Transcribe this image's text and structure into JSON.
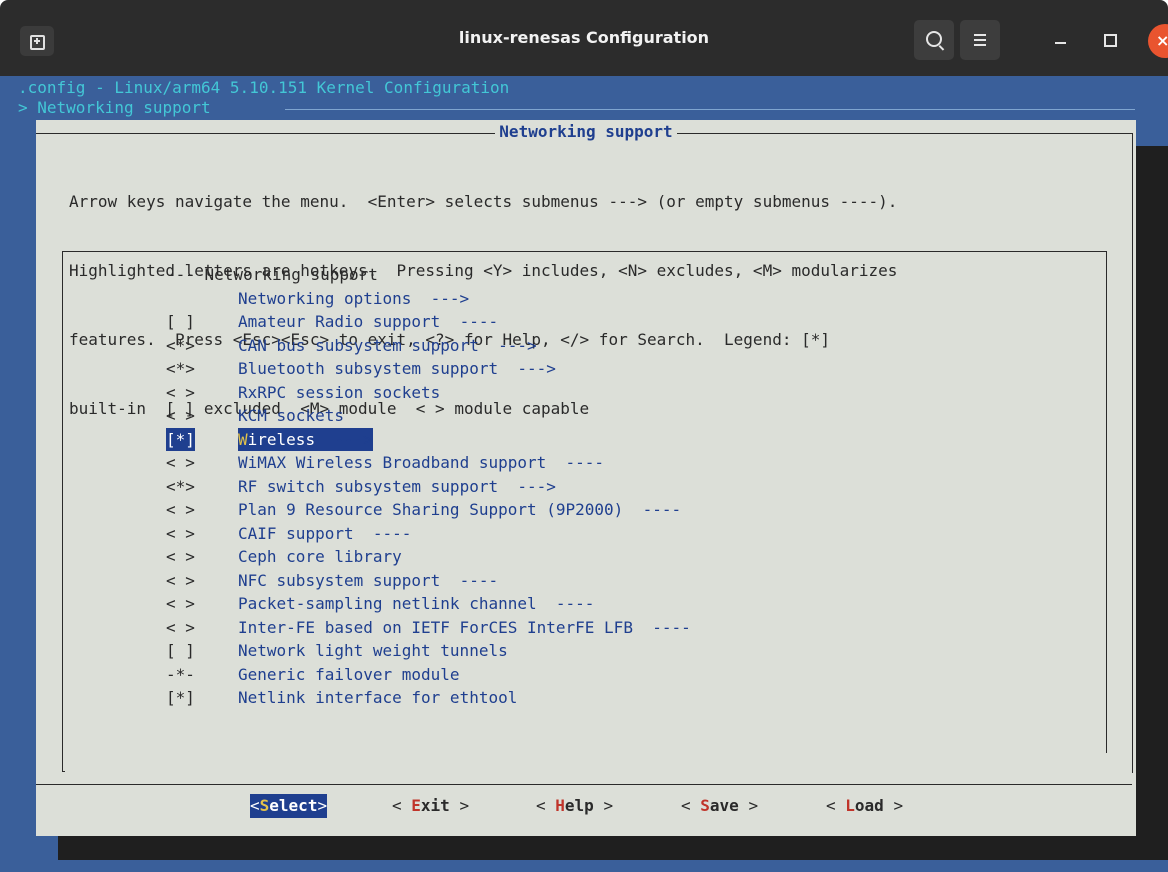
{
  "window": {
    "title": "linux-renesas Configuration",
    "close_glyph": "×",
    "icons": [
      "new-tab-icon",
      "search-icon",
      "hamburger-menu-icon",
      "minimize-icon",
      "maximize-icon",
      "close-icon"
    ]
  },
  "terminal": {
    "path_line": ".config - Linux/arm64 5.10.151 Kernel Configuration",
    "breadcrumb": "> Networking support"
  },
  "dialog": {
    "title": "Networking support",
    "help_lines": [
      "Arrow keys navigate the menu.  <Enter> selects submenus ---> (or empty submenus ----).",
      "Highlighted letters are hotkeys.  Pressing <Y> includes, <N> excludes, <M> modularizes",
      "features.  Press <Esc><Esc> to exit, <?> for Help, </> for Search.  Legend: [*]",
      "built-in  [ ] excluded  <M> module  < > module capable"
    ],
    "items": [
      {
        "mark": "---",
        "hot": "",
        "label": "Networking support",
        "tail": ""
      },
      {
        "mark": "",
        "hot": "Ne",
        "label": "tworking options",
        "tail": "  --->"
      },
      {
        "mark": "[ ]",
        "hot": "A",
        "label": "mateur Radio support",
        "tail": "  ----"
      },
      {
        "mark": "<*>",
        "hot": "",
        "label": "CAN bus subsystem support",
        "tail": "  --->"
      },
      {
        "mark": "<*>",
        "hot": "",
        "label": "Bluetooth subsystem support",
        "tail": "  --->"
      },
      {
        "mark": "< >",
        "hot": "R",
        "label": "xRPC session sockets",
        "tail": ""
      },
      {
        "mark": "< >",
        "hot": "K",
        "label": "CM sockets",
        "tail": ""
      },
      {
        "mark": "[*]",
        "hot": "W",
        "label": "ireless",
        "tail": "  --->"
      },
      {
        "mark": "< >",
        "hot": "W",
        "label": "iMAX Wireless Broadband support",
        "tail": "  ----"
      },
      {
        "mark": "<*>",
        "hot": "R",
        "label": "F switch subsystem support",
        "tail": "  --->"
      },
      {
        "mark": "< >",
        "hot": "",
        "label": "Plan 9 Resource Sharing Support (9P2000)",
        "tail": "  ----"
      },
      {
        "mark": "< >",
        "hot": "C",
        "label": "AIF support",
        "tail": "  ----"
      },
      {
        "mark": "< >",
        "hot": "",
        "label": "Ceph core library",
        "tail": ""
      },
      {
        "mark": "< >",
        "hot": "N",
        "label": "FC subsystem support",
        "tail": "  ----"
      },
      {
        "mark": "< >",
        "hot": "",
        "label": "Packet-sampling netlink channel",
        "tail": "  ----"
      },
      {
        "mark": "< >",
        "hot": "",
        "label": "Inter-FE based on IETF ForCES InterFE LFB",
        "tail": "  ----"
      },
      {
        "mark": "[ ]",
        "hot": "Ne",
        "label": "twork light weight tunnels",
        "tail": ""
      },
      {
        "mark": "-*-",
        "hot": "",
        "label": "Generic failover module",
        "tail": ""
      },
      {
        "mark": "[*]",
        "hot": "Net",
        "label": "link interface for ethtool",
        "tail": ""
      }
    ],
    "selected_index": 7,
    "buttons": [
      {
        "pre": "<",
        "hot": "S",
        "rest": "elect",
        "post": ">"
      },
      {
        "pre": "< ",
        "hot": "E",
        "rest": "xit",
        "post": " >"
      },
      {
        "pre": "< ",
        "hot": "H",
        "rest": "elp",
        "post": " >"
      },
      {
        "pre": "< ",
        "hot": "S",
        "rest": "ave",
        "post": " >"
      },
      {
        "pre": "< ",
        "hot": "L",
        "rest": "oad",
        "post": " >"
      }
    ],
    "active_button": 0
  }
}
